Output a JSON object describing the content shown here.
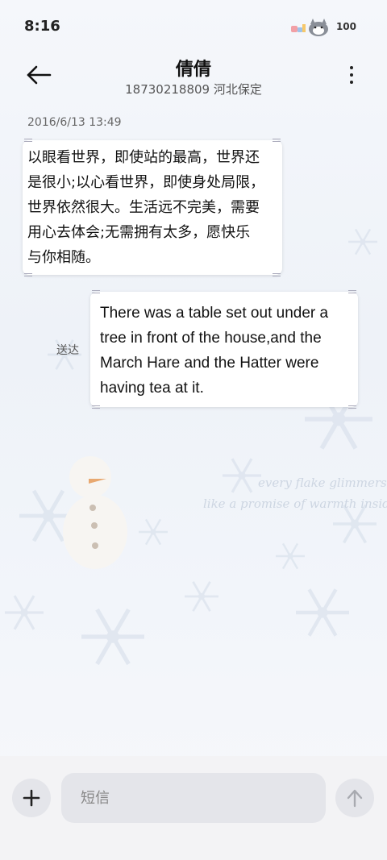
{
  "status_bar": {
    "time": "8:16",
    "battery": "100"
  },
  "header": {
    "contact_name": "倩倩",
    "contact_sub": "18730218809 河北保定"
  },
  "conversation": {
    "timestamp": "2016/6/13 13:49",
    "messages": [
      {
        "direction": "incoming",
        "lines": [
          "以眼看世界，即使站的最高，世界还",
          "是很小;以心看世界，即使身处局限，",
          "世界依然很大。生活远不完美，需要",
          "用心去体会;无需拥有太多，愿快乐",
          "与你相随。"
        ]
      },
      {
        "direction": "outgoing",
        "lines": [
          "There was a table set out under a",
          "tree in front of the house,and the",
          "March Hare and the Hatter were",
          "having tea at it."
        ],
        "status": "送达"
      }
    ]
  },
  "composer": {
    "placeholder": "短信"
  },
  "background": {
    "watermark_line1": "every flake glimmers",
    "watermark_line2": "like a promise of warmth inside"
  },
  "icons": [
    "back-arrow-icon",
    "more-vertical-icon",
    "plus-icon",
    "send-arrow-icon",
    "cat-sticker-icon",
    "snowflake-icon",
    "snowman-icon"
  ]
}
